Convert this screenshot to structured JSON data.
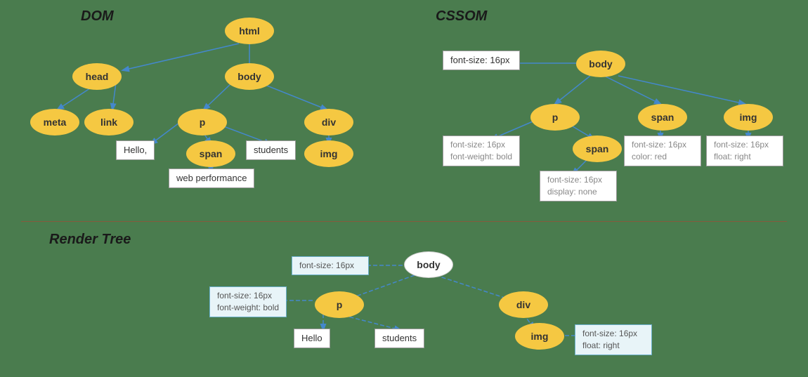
{
  "sections": {
    "dom": {
      "label": "DOM"
    },
    "cssom": {
      "label": "CSSOM"
    },
    "render_tree": {
      "label": "Render Tree"
    }
  },
  "dom_nodes": {
    "html": "html",
    "head": "head",
    "body": "body",
    "meta": "meta",
    "link": "link",
    "p": "p",
    "div": "div",
    "hello": "Hello,",
    "span": "span",
    "students": "students",
    "img": "img",
    "web_performance": "web performance"
  },
  "cssom_nodes": {
    "body": "body",
    "font_size_16_body": "font-size: 16px",
    "p": "p",
    "p_styles": "font-size: 16px\nfont-weight: bold",
    "span_node": "span",
    "span_styles": "font-size: 16px\ndisplay: none",
    "span_label": "span",
    "span_label_styles": "font-size: 16px\ncolor: red",
    "img": "img",
    "img_styles": "font-size: 16px\nfloat: right"
  },
  "render_nodes": {
    "body": "body",
    "font_size_16": "font-size: 16px",
    "p": "p",
    "p_styles": "font-size: 16px\nfont-weight: bold",
    "hello": "Hello",
    "students": "students",
    "div": "div",
    "img": "img",
    "img_styles": "font-size: 16px\nfloat: right"
  }
}
